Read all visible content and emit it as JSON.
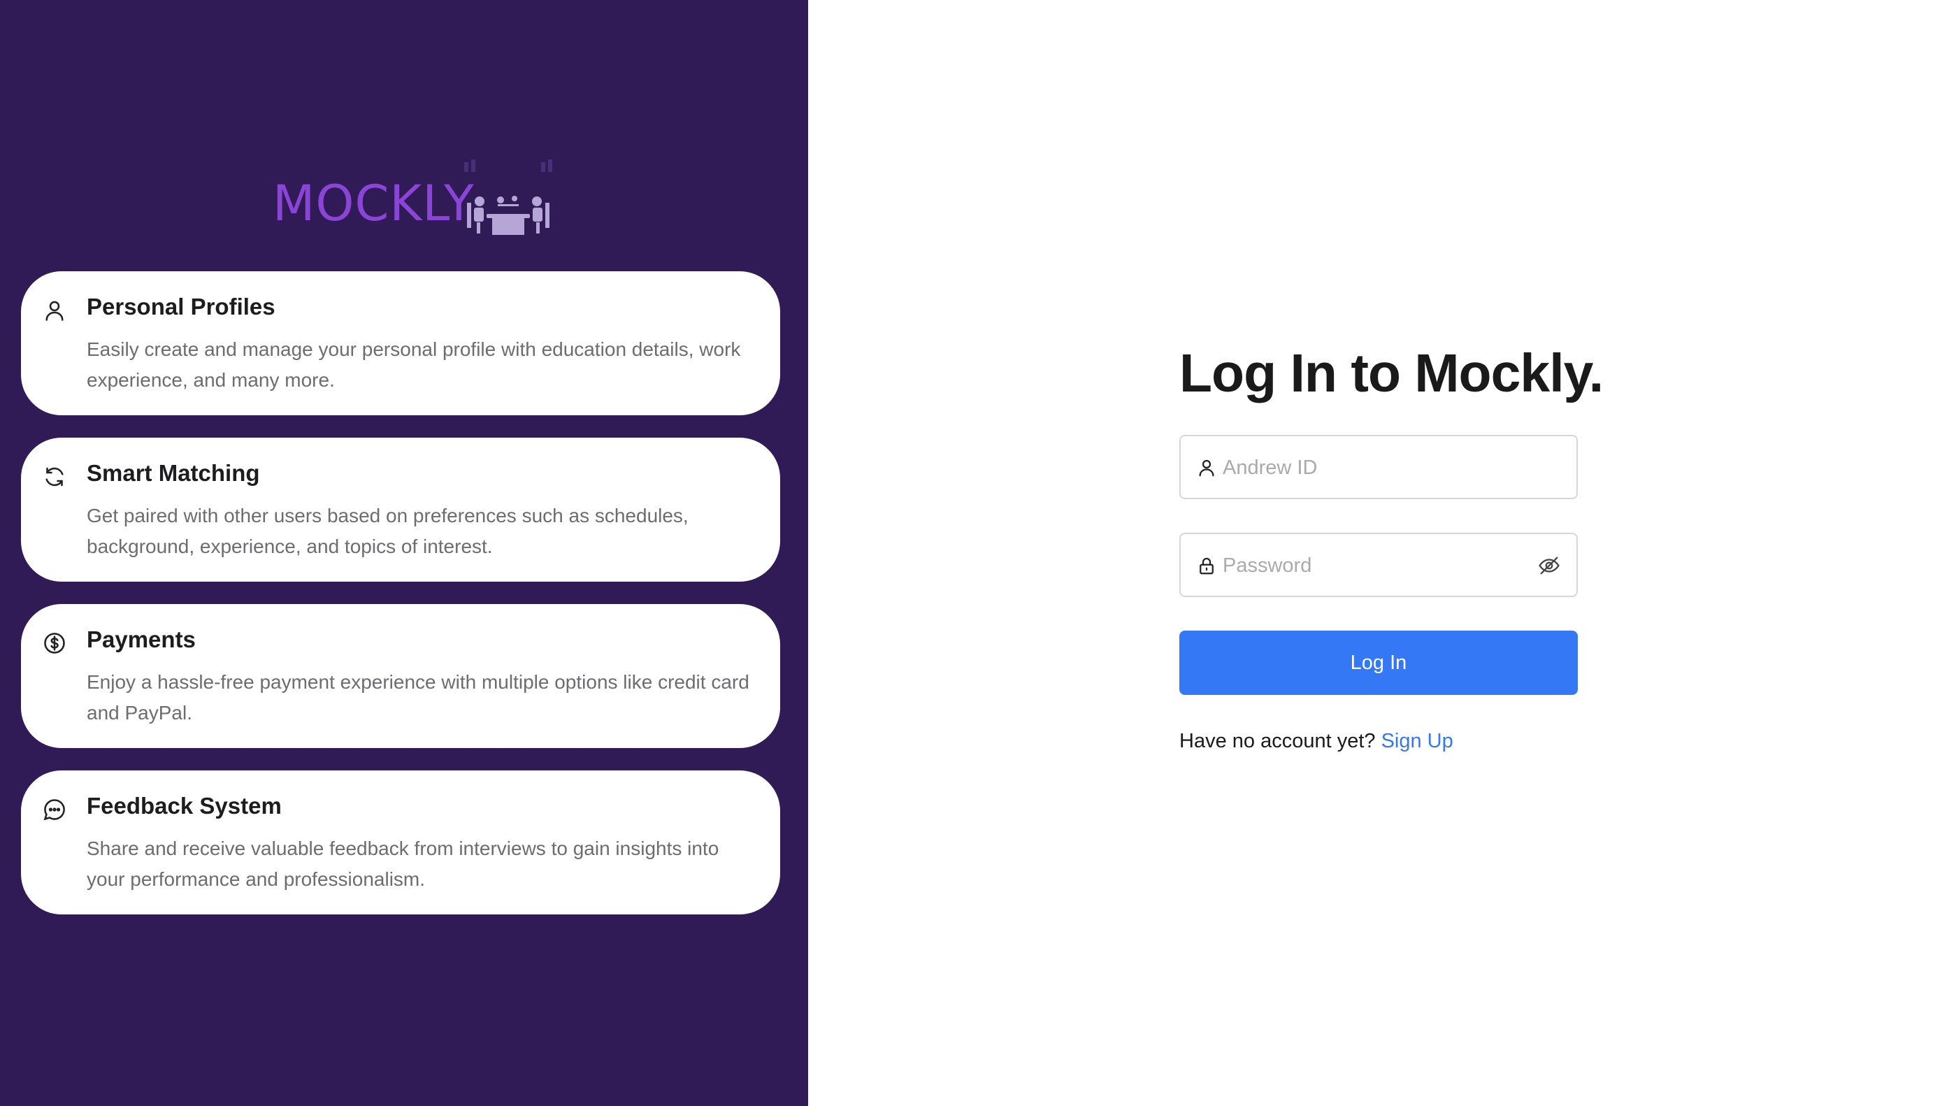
{
  "brand": {
    "name": "MOCKLY"
  },
  "features": [
    {
      "icon": "user-icon",
      "title": "Personal Profiles",
      "description": "Easily create and manage your personal profile with education details, work experience, and many more."
    },
    {
      "icon": "refresh-icon",
      "title": "Smart Matching",
      "description": "Get paired with other users based on preferences such as schedules, background, experience, and topics of interest."
    },
    {
      "icon": "dollar-icon",
      "title": "Payments",
      "description": "Enjoy a hassle-free payment experience with multiple options like credit card and PayPal."
    },
    {
      "icon": "chat-icon",
      "title": "Feedback System",
      "description": "Share and receive valuable feedback from interviews to gain insights into your performance and professionalism."
    }
  ],
  "login": {
    "heading": "Log In to Mockly.",
    "andrew_id": {
      "placeholder": "Andrew ID",
      "value": "",
      "icon": "user-icon"
    },
    "password": {
      "placeholder": "Password",
      "value": "",
      "icon": "lock-icon",
      "toggle_icon": "eye-slash-icon"
    },
    "submit_label": "Log In",
    "signup_prompt": "Have no account yet?",
    "signup_link": "Sign Up"
  },
  "colors": {
    "panel": "#311b56",
    "brand": "#8b45d6",
    "primary": "#3478f6"
  }
}
